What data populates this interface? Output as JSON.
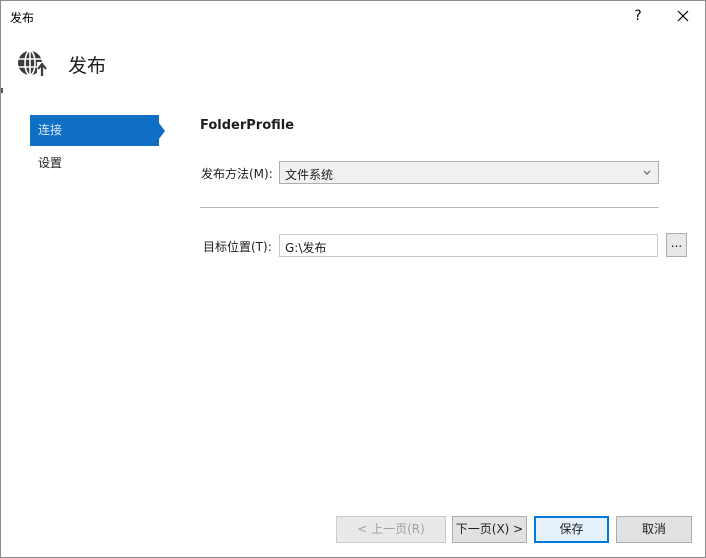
{
  "window": {
    "title": "发布",
    "help_label": "?",
    "close_icon": "close-icon"
  },
  "header": {
    "icon": "globe-publish-icon",
    "title": "发布"
  },
  "nav": {
    "items": [
      {
        "label": "连接",
        "selected": true
      },
      {
        "label": "设置",
        "selected": false
      }
    ],
    "selected_color": "#0e6fc4"
  },
  "main": {
    "profile_name": "FolderProfile",
    "publish_method": {
      "label": "发布方法(M):",
      "value": "文件系统"
    },
    "target_location": {
      "label": "目标位置(T):",
      "value": "G:\\发布",
      "browse_label": "..."
    }
  },
  "footer": {
    "prev_label": "< 上一页(R)",
    "next_label": "下一页(X) >",
    "save_label": "保存",
    "cancel_label": "取消"
  }
}
